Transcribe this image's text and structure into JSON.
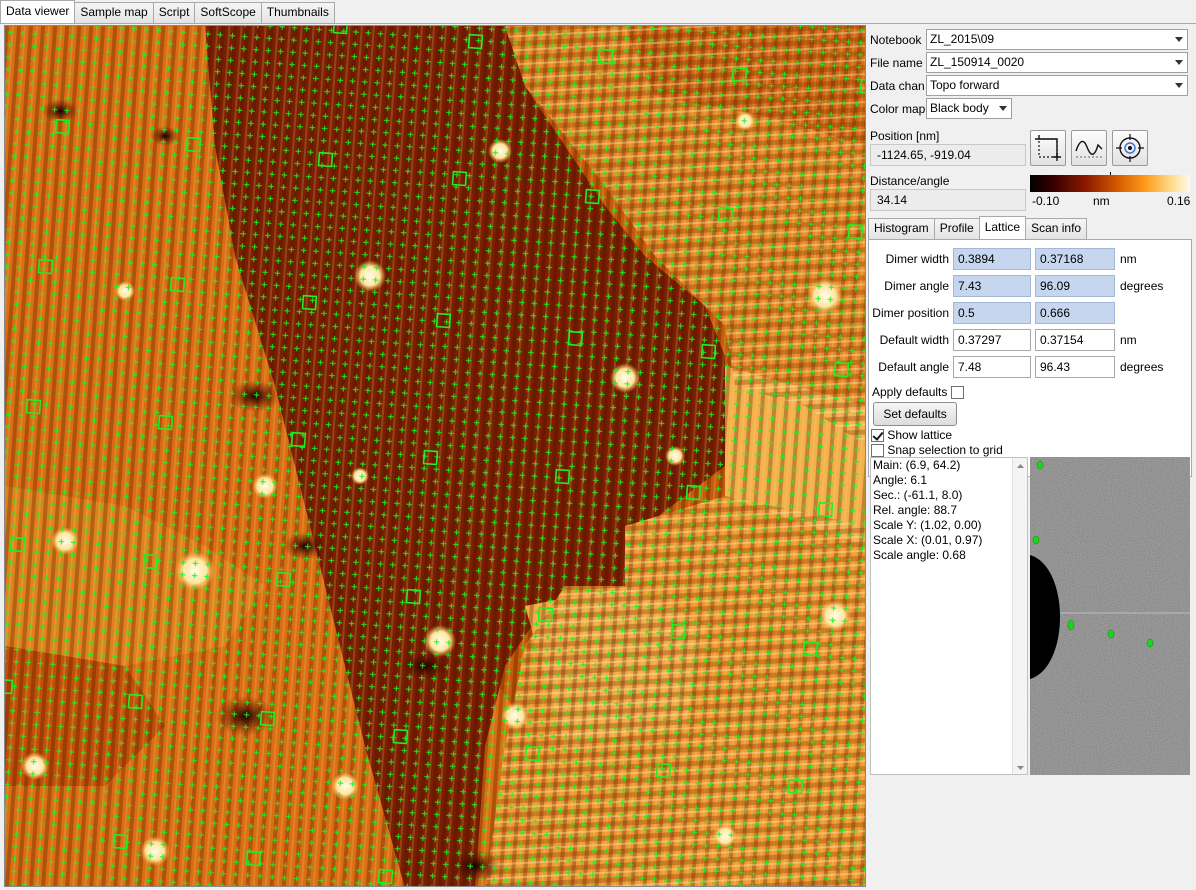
{
  "tabs": [
    "Data viewer",
    "Sample map",
    "Script",
    "SoftScope",
    "Thumbnails"
  ],
  "controls": {
    "notebook_label": "Notebook",
    "notebook_value": "ZL_2015\\09",
    "filename_label": "File name",
    "filename_value": "ZL_150914_0020",
    "datachan_label": "Data chan",
    "datachan_value": "Topo forward",
    "colormap_label": "Color map",
    "colormap_value": "Black body",
    "position_label": "Position [nm]",
    "position_value": "-1124.65, -919.04",
    "distance_label": "Distance/angle",
    "distance_value": "34.14"
  },
  "colorbar": {
    "min_label": "-0.10",
    "unit_label": "nm",
    "max_label": "0.16"
  },
  "tools": [
    "crop-select-icon",
    "line-profile-icon",
    "target-icon"
  ],
  "subtabs": [
    "Histogram",
    "Profile",
    "Lattice",
    "Scan info"
  ],
  "lattice": {
    "dimer_width_label": "Dimer width",
    "dimer_width_a": "0.3894",
    "dimer_width_b": "0.37168",
    "dimer_width_unit": "nm",
    "dimer_angle_label": "Dimer angle",
    "dimer_angle_a": "7.43",
    "dimer_angle_b": "96.09",
    "dimer_angle_unit": "degrees",
    "dimer_position_label": "Dimer position",
    "dimer_position_a": "0.5",
    "dimer_position_b": "0.666",
    "default_width_label": "Default width",
    "default_width_a": "0.37297",
    "default_width_b": "0.37154",
    "default_width_unit": "nm",
    "default_angle_label": "Default angle",
    "default_angle_a": "7.48",
    "default_angle_b": "96.43",
    "default_angle_unit": "degrees",
    "apply_defaults_label": "Apply defaults",
    "apply_defaults_checked": false,
    "set_defaults_label": "Set defaults",
    "show_lattice_label": "Show lattice",
    "show_lattice_checked": true,
    "snap_label": "Snap selection to grid",
    "snap_checked": false
  },
  "info_lines": [
    "Main: (6.9, 64.2)",
    "Angle: 6.1",
    "Sec.: (-61.1, 8.0)",
    "Rel. angle: 88.7",
    "Scale Y: (1.02, 0.00)",
    "Scale X: (0.01, 0.97)",
    "Scale angle: 0.68"
  ],
  "colors": {
    "lattice_marker": "#22ee22",
    "panel_bg": "#f0f0f0",
    "highlight_field": "#c6d6ee"
  }
}
